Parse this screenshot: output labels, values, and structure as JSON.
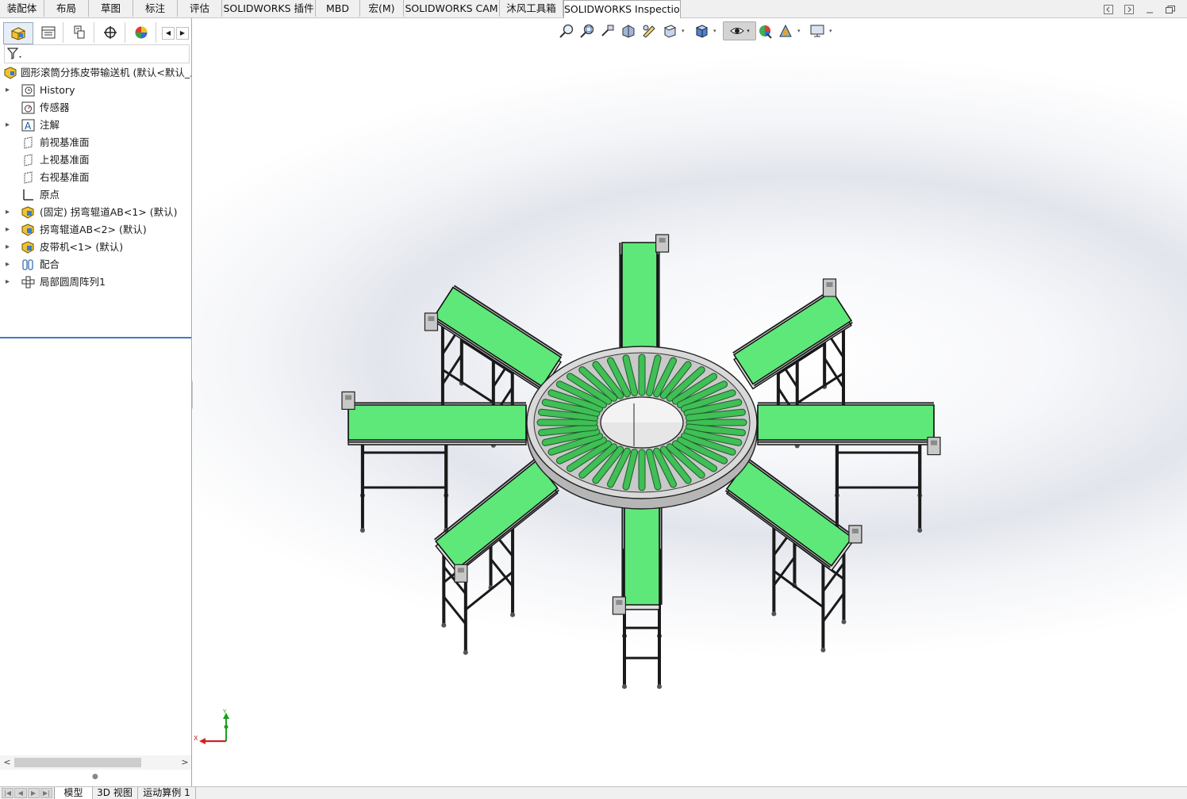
{
  "command_tabs": [
    "装配体",
    "布局",
    "草图",
    "标注",
    "评估",
    "SOLIDWORKS 插件",
    "MBD",
    "宏(M)",
    "SOLIDWORKS CAM",
    "沐风工具箱",
    "SOLIDWORKS Inspection"
  ],
  "active_command_tab": "SOLIDWORKS Inspection",
  "feature_manager": {
    "panel_tabs": [
      "feature-manager",
      "property-manager",
      "configuration-manager",
      "dimxpert-manager",
      "display-manager"
    ],
    "root": "圆形滚筒分拣皮带输送机  (默认<默认_显",
    "items": [
      {
        "label": "History",
        "icon": "history-icon",
        "expandable": true
      },
      {
        "label": "传感器",
        "icon": "sensor-icon",
        "expandable": false
      },
      {
        "label": "注解",
        "icon": "annotation-icon",
        "expandable": true
      },
      {
        "label": "前视基准面",
        "icon": "plane-icon",
        "expandable": false
      },
      {
        "label": "上视基准面",
        "icon": "plane-icon",
        "expandable": false
      },
      {
        "label": "右视基准面",
        "icon": "plane-icon",
        "expandable": false
      },
      {
        "label": "原点",
        "icon": "origin-icon",
        "expandable": false
      },
      {
        "label": "(固定) 拐弯辊道AB<1> (默认)",
        "icon": "part-icon",
        "expandable": true
      },
      {
        "label": "拐弯辊道AB<2> (默认)",
        "icon": "part-icon",
        "expandable": true
      },
      {
        "label": "皮带机<1> (默认)",
        "icon": "part-icon",
        "expandable": true
      },
      {
        "label": "配合",
        "icon": "mates-icon",
        "expandable": true
      },
      {
        "label": "局部圆周阵列1",
        "icon": "pattern-icon",
        "expandable": true
      }
    ]
  },
  "bottom_tabs": [
    "模型",
    "3D 视图",
    "运动算例 1"
  ],
  "active_bottom_tab": "模型",
  "triad": {
    "y_label": "Y",
    "x_label": "X"
  },
  "colors": {
    "belt": "#5ee87a",
    "roller": "#3fbf55",
    "frame": "#1a1a1a",
    "ring": "#cfcfcf",
    "triad_x": "#d42020",
    "triad_y": "#1aa01a"
  }
}
